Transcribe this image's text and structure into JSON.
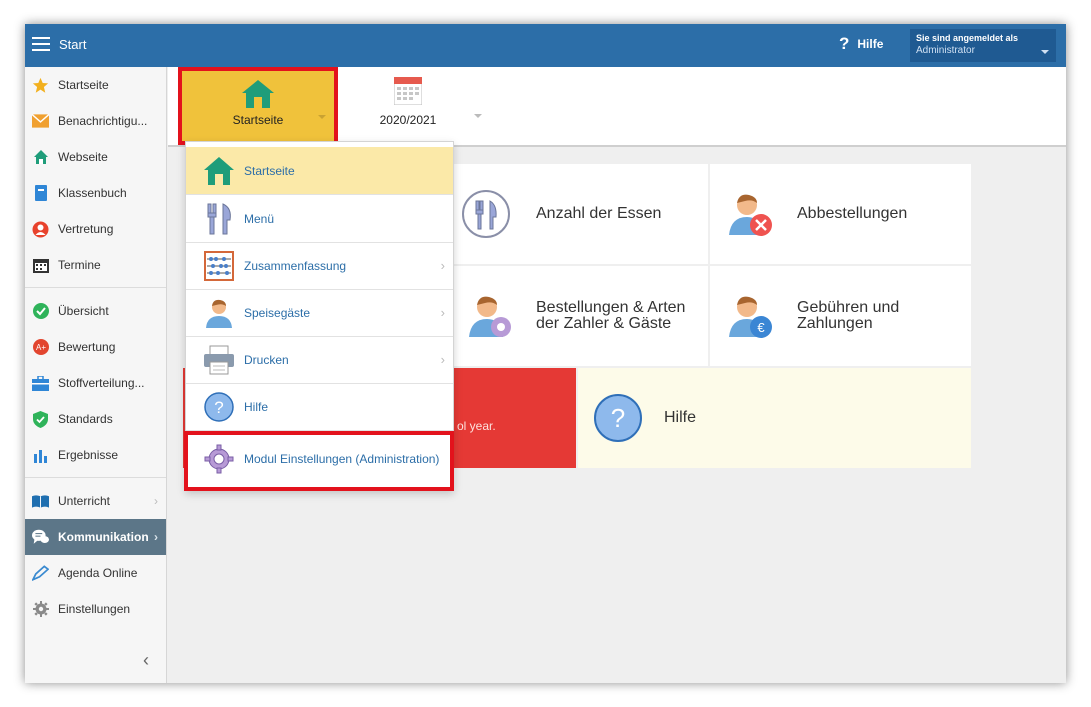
{
  "topbar": {
    "title": "Start",
    "help_label": "Hilfe",
    "help_glyph": "?",
    "login_line1": "Sie sind angemeldet als",
    "login_line2": "Administrator"
  },
  "sidebar": {
    "items": [
      {
        "label": "Startseite",
        "icon": "star-icon"
      },
      {
        "label": "Benachrichtigu...",
        "icon": "envelope-icon"
      },
      {
        "label": "Webseite",
        "icon": "home-icon"
      },
      {
        "label": "Klassenbuch",
        "icon": "book-icon"
      },
      {
        "label": "Vertretung",
        "icon": "person-swap-icon"
      },
      {
        "label": "Termine",
        "icon": "calendar-icon"
      },
      {
        "label": "Übersicht",
        "icon": "check-circle-icon"
      },
      {
        "label": "Bewertung",
        "icon": "rating-icon"
      },
      {
        "label": "Stoffverteilung...",
        "icon": "briefcase-icon"
      },
      {
        "label": "Standards",
        "icon": "shield-check-icon"
      },
      {
        "label": "Ergebnisse",
        "icon": "bar-chart-icon"
      },
      {
        "label": "Unterricht",
        "icon": "open-book-icon"
      },
      {
        "label": "Kommunikation",
        "icon": "chat-icon"
      },
      {
        "label": "Agenda Online",
        "icon": "pen-icon"
      },
      {
        "label": "Einstellungen",
        "icon": "gear-icon"
      }
    ],
    "collapse_glyph": "‹"
  },
  "toolbar": {
    "start_label": "Startseite",
    "year_label": "2020/2021"
  },
  "tiles": {
    "essen": "Anzahl der Essen",
    "abbestellungen": "Abbestellungen",
    "bestellungen": "Bestellungen & Arten der Zahler & Gäste",
    "gebuehren": "Gebühren und Zahlungen",
    "red_text": "ol year.",
    "hilfe": "Hilfe"
  },
  "dropdown": {
    "items": [
      {
        "label": "Startseite",
        "icon": "home-icon"
      },
      {
        "label": "Menü",
        "icon": "cutlery-icon"
      },
      {
        "label": "Zusammenfassung",
        "icon": "abacus-icon"
      },
      {
        "label": "Speisegäste",
        "icon": "person-icon"
      },
      {
        "label": "Drucken",
        "icon": "printer-icon"
      },
      {
        "label": "Hilfe",
        "icon": "help-icon"
      },
      {
        "label": "Modul Einstellungen (Administration)",
        "icon": "gear-icon"
      }
    ]
  },
  "colors": {
    "topbar": "#2c6ea8",
    "highlight_yellow": "#f0c23b",
    "callout_red": "#e3121c",
    "tile_red": "#e53935",
    "tile_cream": "#fdfbe9",
    "sidebar_active": "#5c7688"
  }
}
